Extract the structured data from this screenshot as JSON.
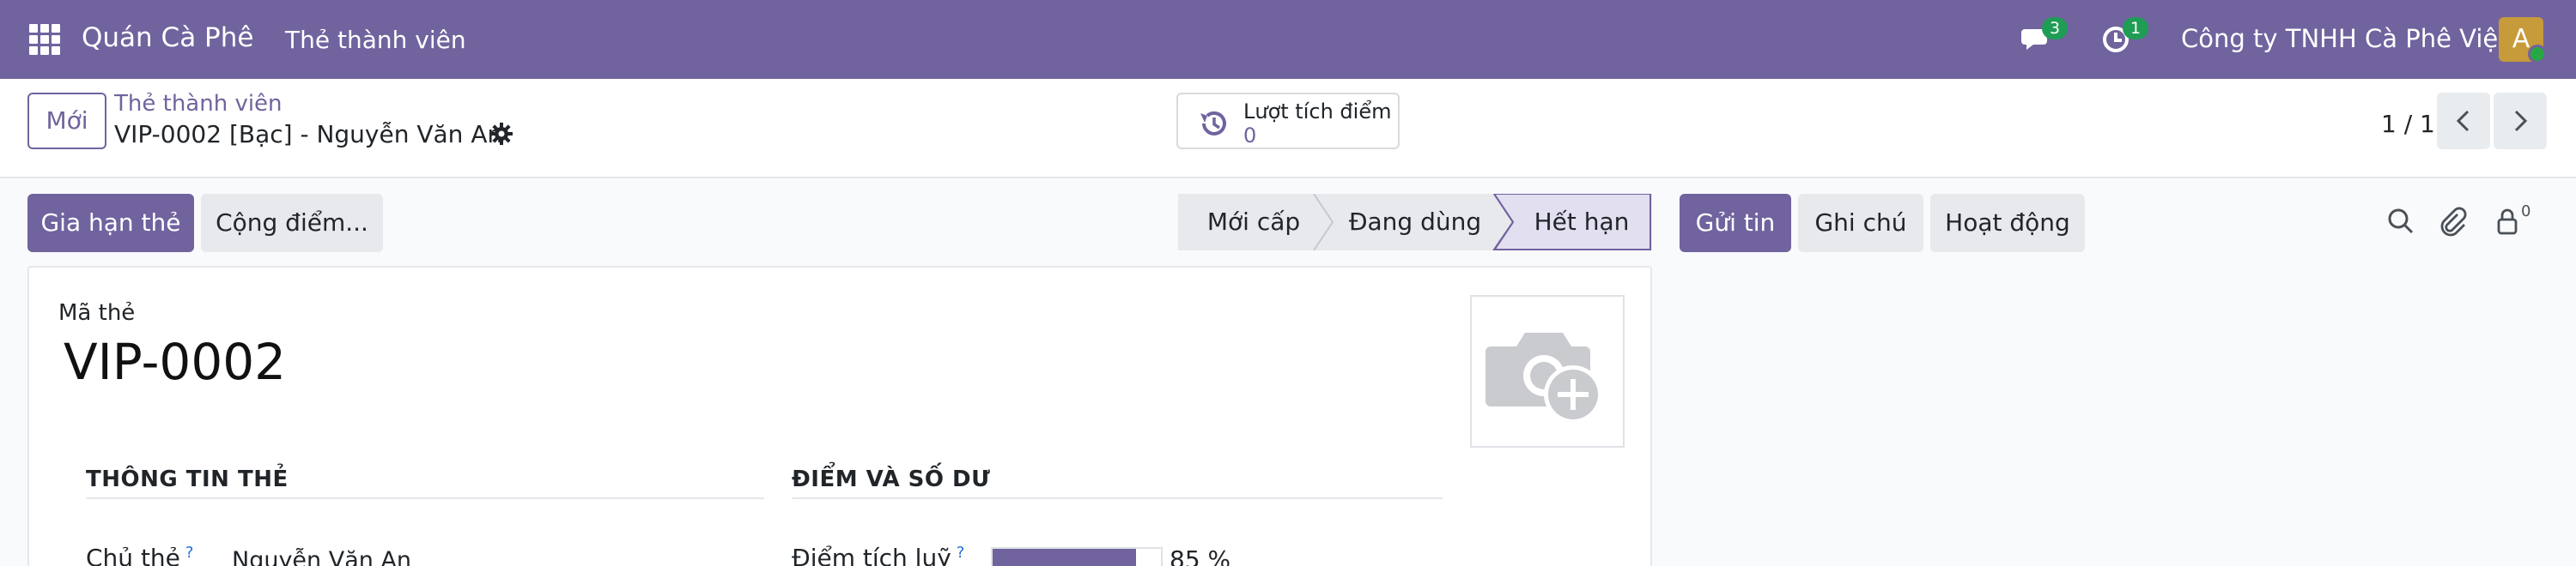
{
  "navbar": {
    "brand": "Quán Cà Phê",
    "menu": "Thẻ thành viên",
    "messages_count": "3",
    "activities_count": "1",
    "company": "Công ty TNHH Cà Phê Việt",
    "avatar_letter": "A"
  },
  "control_panel": {
    "new_button": "Mới",
    "breadcrumb_parent": "Thẻ thành viên",
    "breadcrumb_current": "VIP-0002 [Bạc] - Nguyễn Văn An",
    "smart_button": {
      "label": "Lượt tích điểm",
      "value": "0"
    },
    "pager": "1 / 1"
  },
  "actions": {
    "renew": "Gia hạn thẻ",
    "add_points": "Cộng điểm..."
  },
  "status_bar": {
    "stages": [
      "Mới cấp",
      "Đang dùng",
      "Hết hạn"
    ],
    "active_stage": "Hết hạn"
  },
  "chatter": {
    "send_message": "Gửi tin",
    "log_note": "Ghi chú",
    "activities": "Hoạt động",
    "followers_count": "0"
  },
  "form": {
    "code_label": "Mã thẻ",
    "code_value": "VIP-0002",
    "section_card_info": "THÔNG TIN THẺ",
    "section_points": "ĐIỂM VÀ SỐ DƯ",
    "holder_label": "Chủ thẻ",
    "holder_help": "?",
    "holder_value": "Nguyễn Văn An",
    "points_label": "Điểm tích luỹ",
    "points_help": "?",
    "points_percent": 85,
    "points_percent_text": "85 %"
  },
  "colors": {
    "brand": "#71639e",
    "badge": "#1f9d55"
  }
}
